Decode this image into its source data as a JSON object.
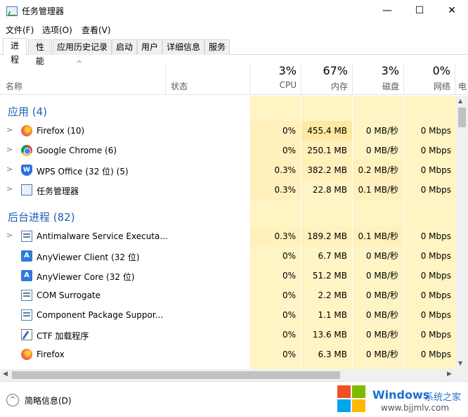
{
  "window": {
    "title": "任务管理器",
    "minimize": "—",
    "maximize": "☐",
    "close": "✕"
  },
  "menu": [
    "文件(F)",
    "选项(O)",
    "查看(V)"
  ],
  "tabs": [
    "进程",
    "性能",
    "应用历史记录",
    "启动",
    "用户",
    "详细信息",
    "服务"
  ],
  "active_tab": "进程",
  "columns": {
    "name": "名称",
    "status": "状态",
    "cpu": {
      "pct": "3%",
      "label": "CPU"
    },
    "memory": {
      "pct": "67%",
      "label": "内存"
    },
    "disk": {
      "pct": "3%",
      "label": "磁盘"
    },
    "network": {
      "pct": "0%",
      "label": "网络"
    },
    "power_partial": "电"
  },
  "groups": {
    "apps": "应用 (4)",
    "background": "后台进程 (82)"
  },
  "apps": [
    {
      "name": "Firefox (10)",
      "icon": "firefox-icon",
      "cpu": "0%",
      "mem": "455.4 MB",
      "disk": "0 MB/秒",
      "net": "0 Mbps"
    },
    {
      "name": "Google Chrome (6)",
      "icon": "chrome-icon",
      "cpu": "0%",
      "mem": "250.1 MB",
      "disk": "0 MB/秒",
      "net": "0 Mbps"
    },
    {
      "name": "WPS Office (32 位) (5)",
      "icon": "wps-icon",
      "cpu": "0.3%",
      "mem": "382.2 MB",
      "disk": "0.2 MB/秒",
      "net": "0 Mbps"
    },
    {
      "name": "任务管理器",
      "icon": "task-manager-icon",
      "cpu": "0.3%",
      "mem": "22.8 MB",
      "disk": "0.1 MB/秒",
      "net": "0 Mbps"
    }
  ],
  "background": [
    {
      "name": "Antimalware Service Executa...",
      "icon": "service-icon",
      "cpu": "0.3%",
      "mem": "189.2 MB",
      "disk": "0.1 MB/秒",
      "net": "0 Mbps"
    },
    {
      "name": "AnyViewer Client (32 位)",
      "icon": "anyviewer-icon",
      "cpu": "0%",
      "mem": "6.7 MB",
      "disk": "0 MB/秒",
      "net": "0 Mbps"
    },
    {
      "name": "AnyViewer Core (32 位)",
      "icon": "anyviewer-icon",
      "cpu": "0%",
      "mem": "51.2 MB",
      "disk": "0 MB/秒",
      "net": "0 Mbps"
    },
    {
      "name": "COM Surrogate",
      "icon": "service-icon",
      "cpu": "0%",
      "mem": "2.2 MB",
      "disk": "0 MB/秒",
      "net": "0 Mbps"
    },
    {
      "name": "Component Package Suppor...",
      "icon": "service-icon",
      "cpu": "0%",
      "mem": "1.1 MB",
      "disk": "0 MB/秒",
      "net": "0 Mbps"
    },
    {
      "name": "CTF 加载程序",
      "icon": "ctf-icon",
      "cpu": "0%",
      "mem": "13.6 MB",
      "disk": "0 MB/秒",
      "net": "0 Mbps"
    },
    {
      "name": "Firefox",
      "icon": "firefox-icon",
      "cpu": "0%",
      "mem": "6.3 MB",
      "disk": "0 MB/秒",
      "net": "0 Mbps"
    }
  ],
  "footer": {
    "fewer_details": "简略信息(D)"
  },
  "watermark": {
    "title": "Windows",
    "cn": "系统之家",
    "url": "www.bjjmlv.com"
  },
  "colors": {
    "group_title": "#1e5fb8",
    "heat_light": "#fff4c4",
    "heat_medium": "#fff0bc",
    "heat_strong": "#ffe8a0"
  }
}
